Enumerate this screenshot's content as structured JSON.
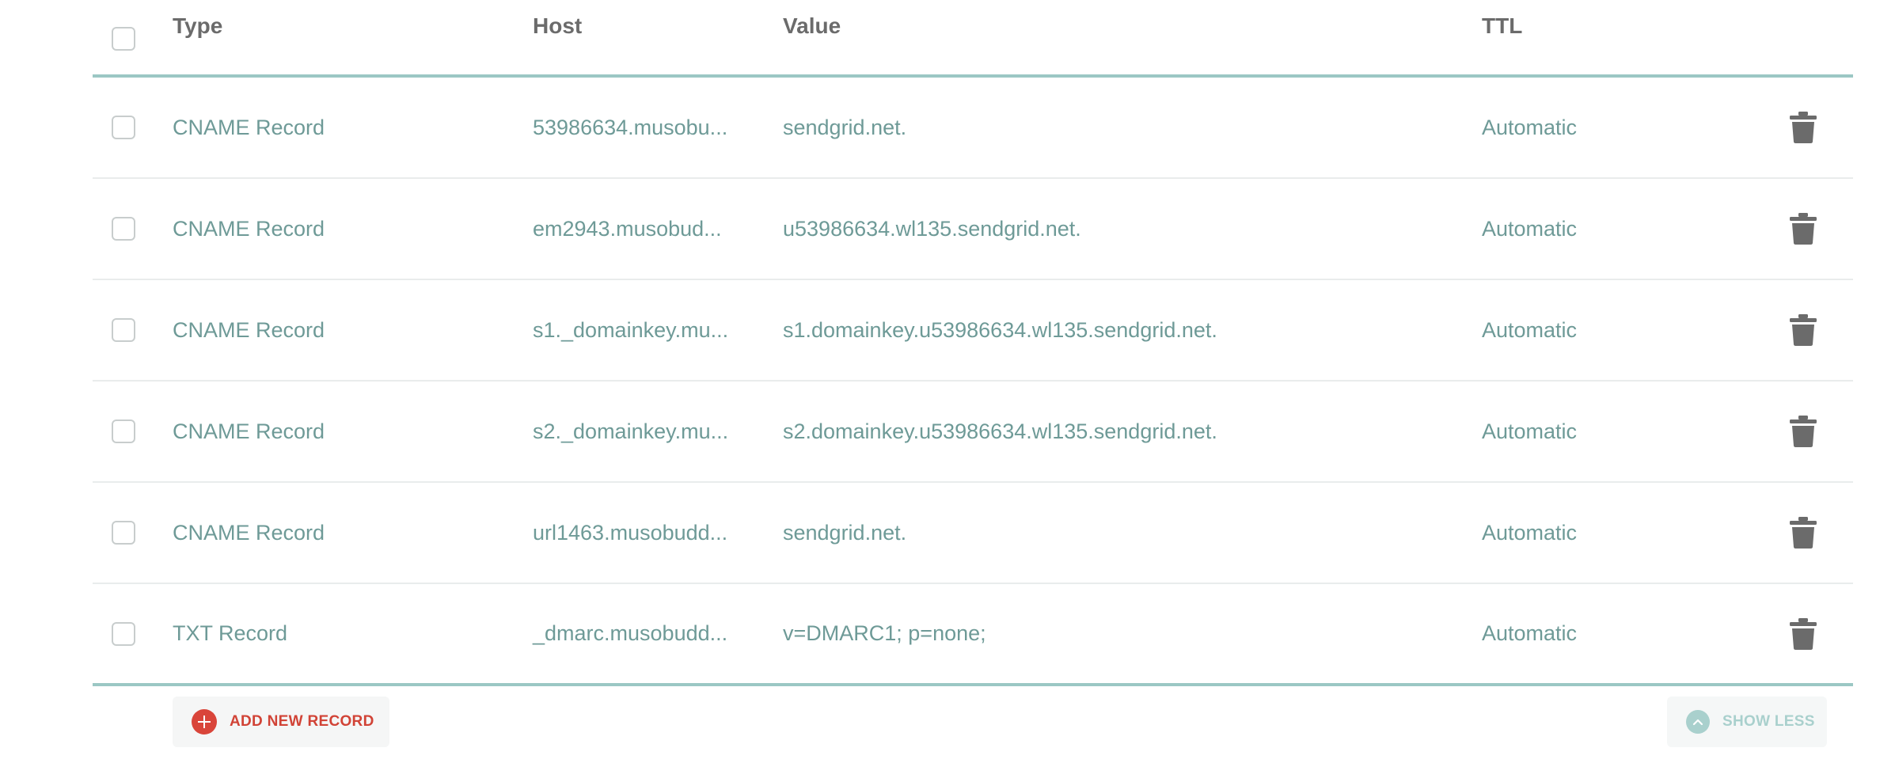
{
  "header": {
    "type": "Type",
    "host": "Host",
    "value": "Value",
    "ttl": "TTL"
  },
  "records": [
    {
      "type": "CNAME Record",
      "host": "53986634.musobu...",
      "value": "sendgrid.net.",
      "ttl": "Automatic"
    },
    {
      "type": "CNAME Record",
      "host": "em2943.musobud...",
      "value": "u53986634.wl135.sendgrid.net.",
      "ttl": "Automatic"
    },
    {
      "type": "CNAME Record",
      "host": "s1._domainkey.mu...",
      "value": "s1.domainkey.u53986634.wl135.sendgrid.net.",
      "ttl": "Automatic"
    },
    {
      "type": "CNAME Record",
      "host": "s2._domainkey.mu...",
      "value": "s2.domainkey.u53986634.wl135.sendgrid.net.",
      "ttl": "Automatic"
    },
    {
      "type": "CNAME Record",
      "host": "url1463.musobudd...",
      "value": "sendgrid.net.",
      "ttl": "Automatic"
    },
    {
      "type": "TXT Record",
      "host": "_dmarc.musobudd...",
      "value": "v=DMARC1; p=none;",
      "ttl": "Automatic"
    }
  ],
  "footer": {
    "add_label": "ADD NEW RECORD",
    "show_less_label": "SHOW LESS"
  },
  "colors": {
    "accent_border": "#9bc7c4",
    "text_value": "#6e9a97",
    "add_red": "#d9453a",
    "show_teal": "#a9d0cd",
    "trash": "#6b6b6b"
  },
  "icons": {
    "delete": "trash-icon",
    "add": "plus-circle-icon",
    "show_less": "chevron-up-icon"
  }
}
